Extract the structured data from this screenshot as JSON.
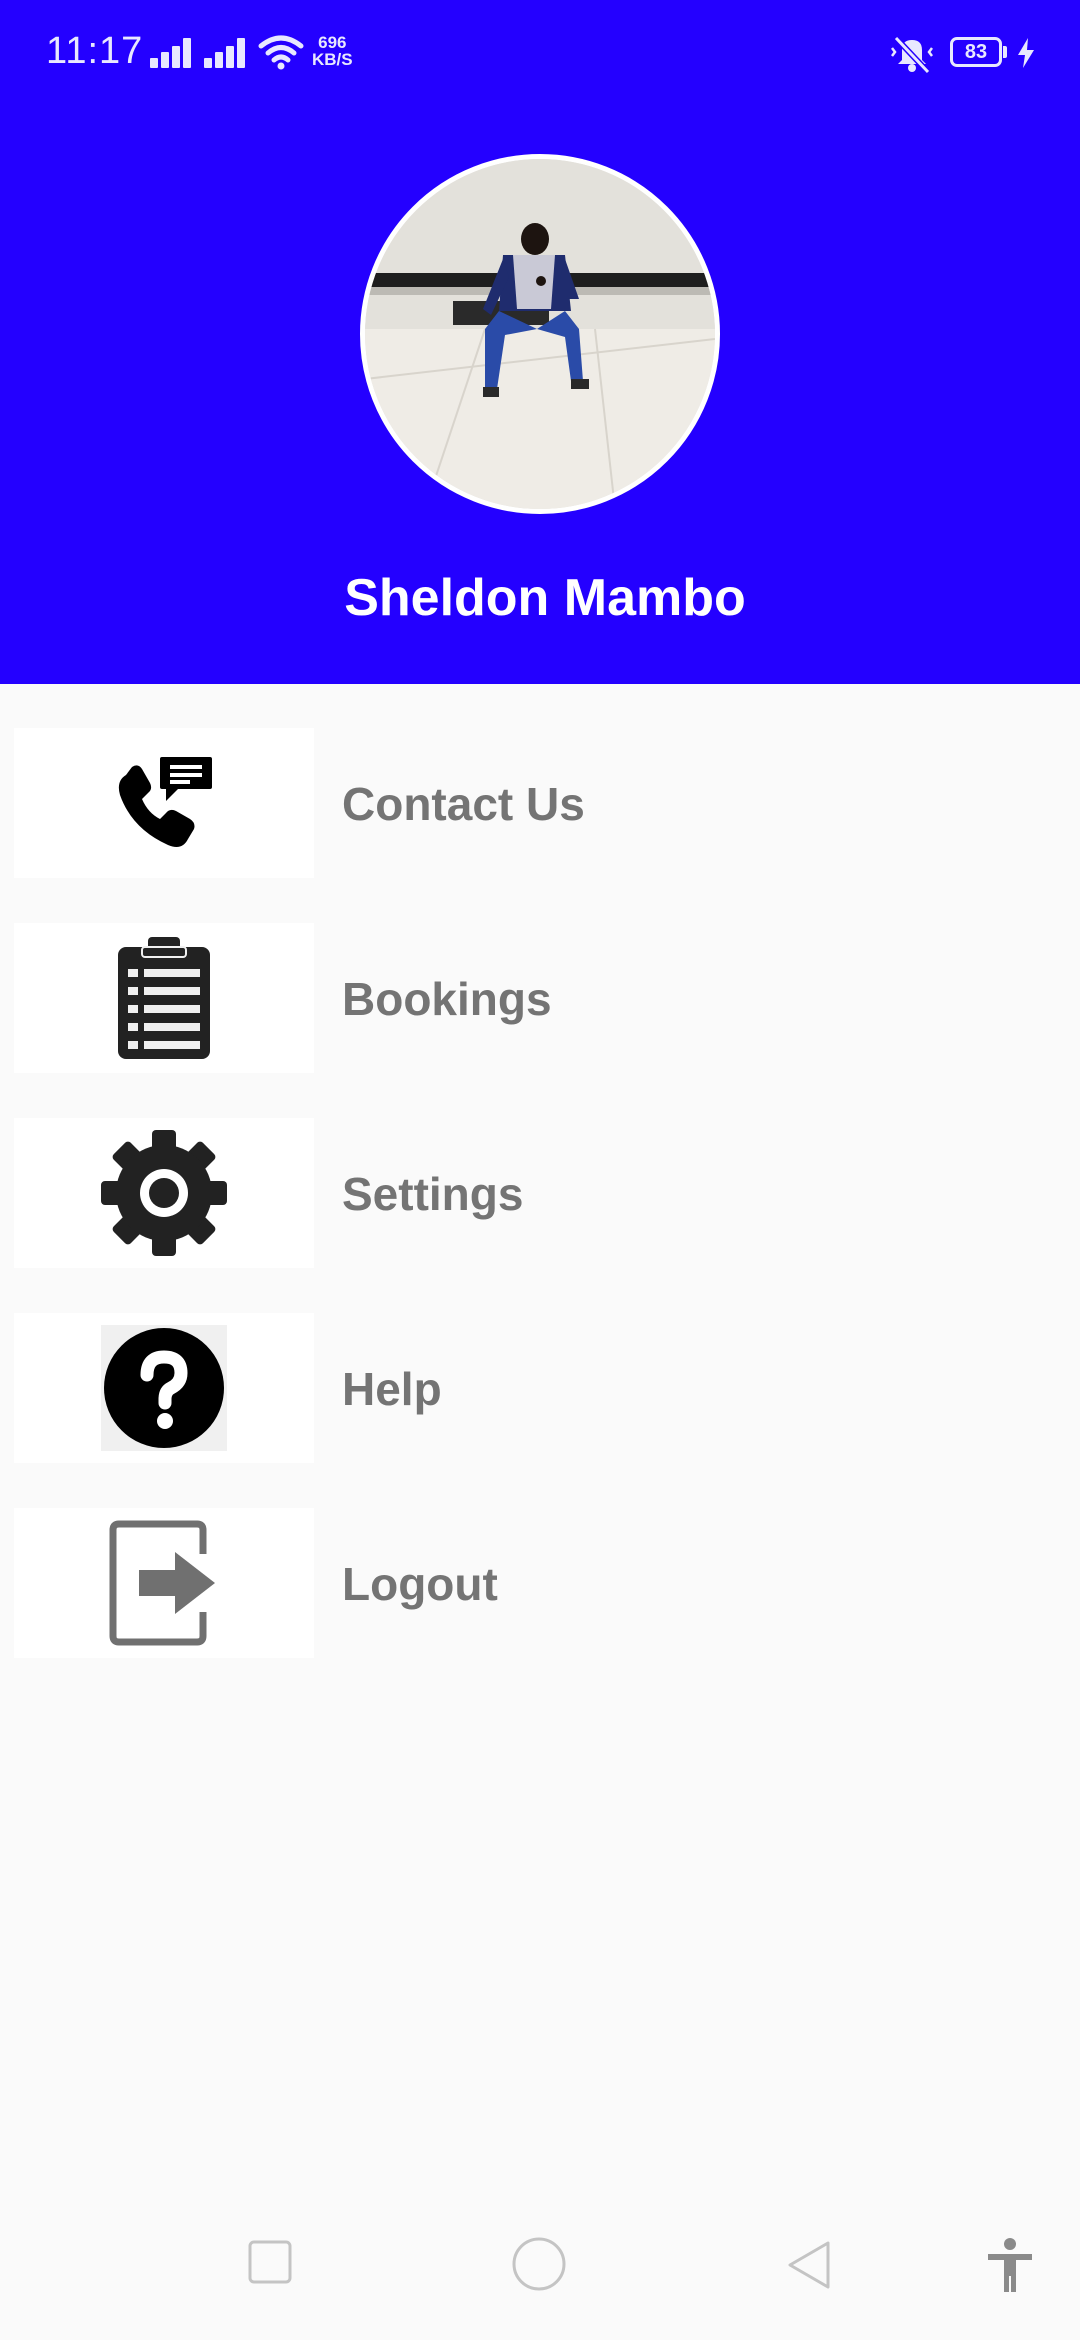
{
  "status_bar": {
    "time": "11:17",
    "net_speed_value": "696",
    "net_speed_unit": "KB/S",
    "battery_level": "83"
  },
  "profile": {
    "name": "Sheldon Mambo"
  },
  "menu": {
    "items": [
      {
        "label": "Contact Us",
        "icon": "phone-message-icon"
      },
      {
        "label": "Bookings",
        "icon": "clipboard-list-icon"
      },
      {
        "label": "Settings",
        "icon": "gear-icon"
      },
      {
        "label": "Help",
        "icon": "question-circle-icon"
      },
      {
        "label": "Logout",
        "icon": "logout-arrow-icon"
      }
    ]
  },
  "colors": {
    "header_bg": "#2400ff",
    "menu_label": "#747474",
    "background": "#fafafa"
  }
}
